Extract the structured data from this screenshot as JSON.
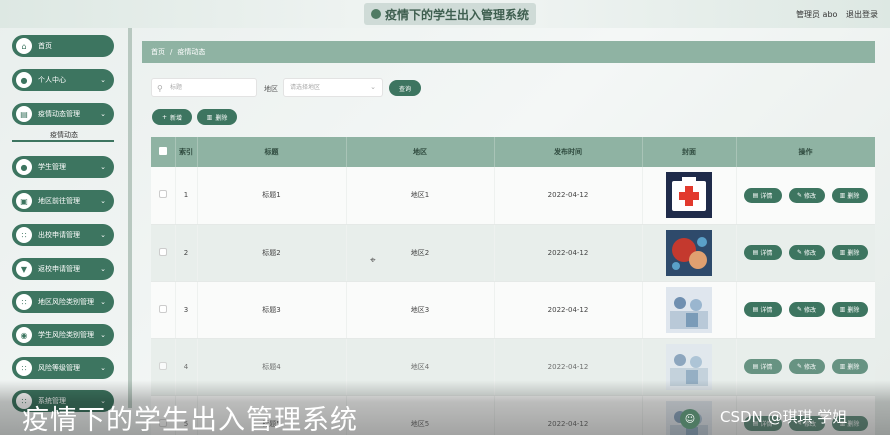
{
  "header": {
    "title": "疫情下的学生出入管理系统",
    "admin": "管理员 abo",
    "logout": "退出登录"
  },
  "sidebar": {
    "items": [
      {
        "label": "首页",
        "icon": "home-icon",
        "chev": ""
      },
      {
        "label": "个人中心",
        "icon": "user-icon",
        "chev": "⌄"
      },
      {
        "label": "疫情动态管理",
        "icon": "doc-icon",
        "chev": "⌄"
      },
      {
        "label": "学生管理",
        "icon": "user-icon",
        "chev": "⌄"
      },
      {
        "label": "地区前往管理",
        "icon": "bag-icon",
        "chev": "⌄"
      },
      {
        "label": "出校申请管理",
        "icon": "grid-icon",
        "chev": "⌄"
      },
      {
        "label": "返校申请管理",
        "icon": "shield-icon",
        "chev": "⌄"
      },
      {
        "label": "地区风险类别管理",
        "icon": "grid-icon",
        "chev": "⌄"
      },
      {
        "label": "学生风险类别管理",
        "icon": "globe-icon",
        "chev": "⌄"
      },
      {
        "label": "风险等级管理",
        "icon": "grid-icon",
        "chev": "⌄"
      },
      {
        "label": "系统管理",
        "icon": "grid-icon",
        "chev": "⌄"
      }
    ],
    "sub_item": "疫情动态"
  },
  "breadcrumb": {
    "home": "首页",
    "sep": "/",
    "current": "疫情动态"
  },
  "search": {
    "title_placeholder": "标题",
    "region_label": "地区",
    "region_placeholder": "请选择地区",
    "query_label": "查询"
  },
  "actions": {
    "add_label": "新增",
    "delete_label": "删除"
  },
  "table": {
    "headers": [
      "",
      "索引",
      "标题",
      "地区",
      "发布时间",
      "封面",
      "操作"
    ],
    "rows": [
      {
        "index": "1",
        "title": "标题1",
        "region": "地区1",
        "date": "2022-04-12",
        "cover": "medical-kit"
      },
      {
        "index": "2",
        "title": "标题2",
        "region": "地区2",
        "date": "2022-04-12",
        "cover": "virus-fist"
      },
      {
        "index": "3",
        "title": "标题3",
        "region": "地区3",
        "date": "2022-04-12",
        "cover": "clinic-scene"
      },
      {
        "index": "4",
        "title": "标题4",
        "region": "地区4",
        "date": "2022-04-12",
        "cover": "clinic-scene"
      },
      {
        "index": "5",
        "title": "标题5",
        "region": "地区5",
        "date": "2022-04-12",
        "cover": "clinic-scene"
      }
    ],
    "ops": {
      "detail": "详情",
      "edit": "修改",
      "delete": "删除"
    }
  },
  "overlay": {
    "caption": "疫情下的学生出入管理系统",
    "watermark": "CSDN @琪琪 学姐"
  },
  "colors": {
    "primary": "#3d7560",
    "header_bg": "#8fb3a3"
  }
}
